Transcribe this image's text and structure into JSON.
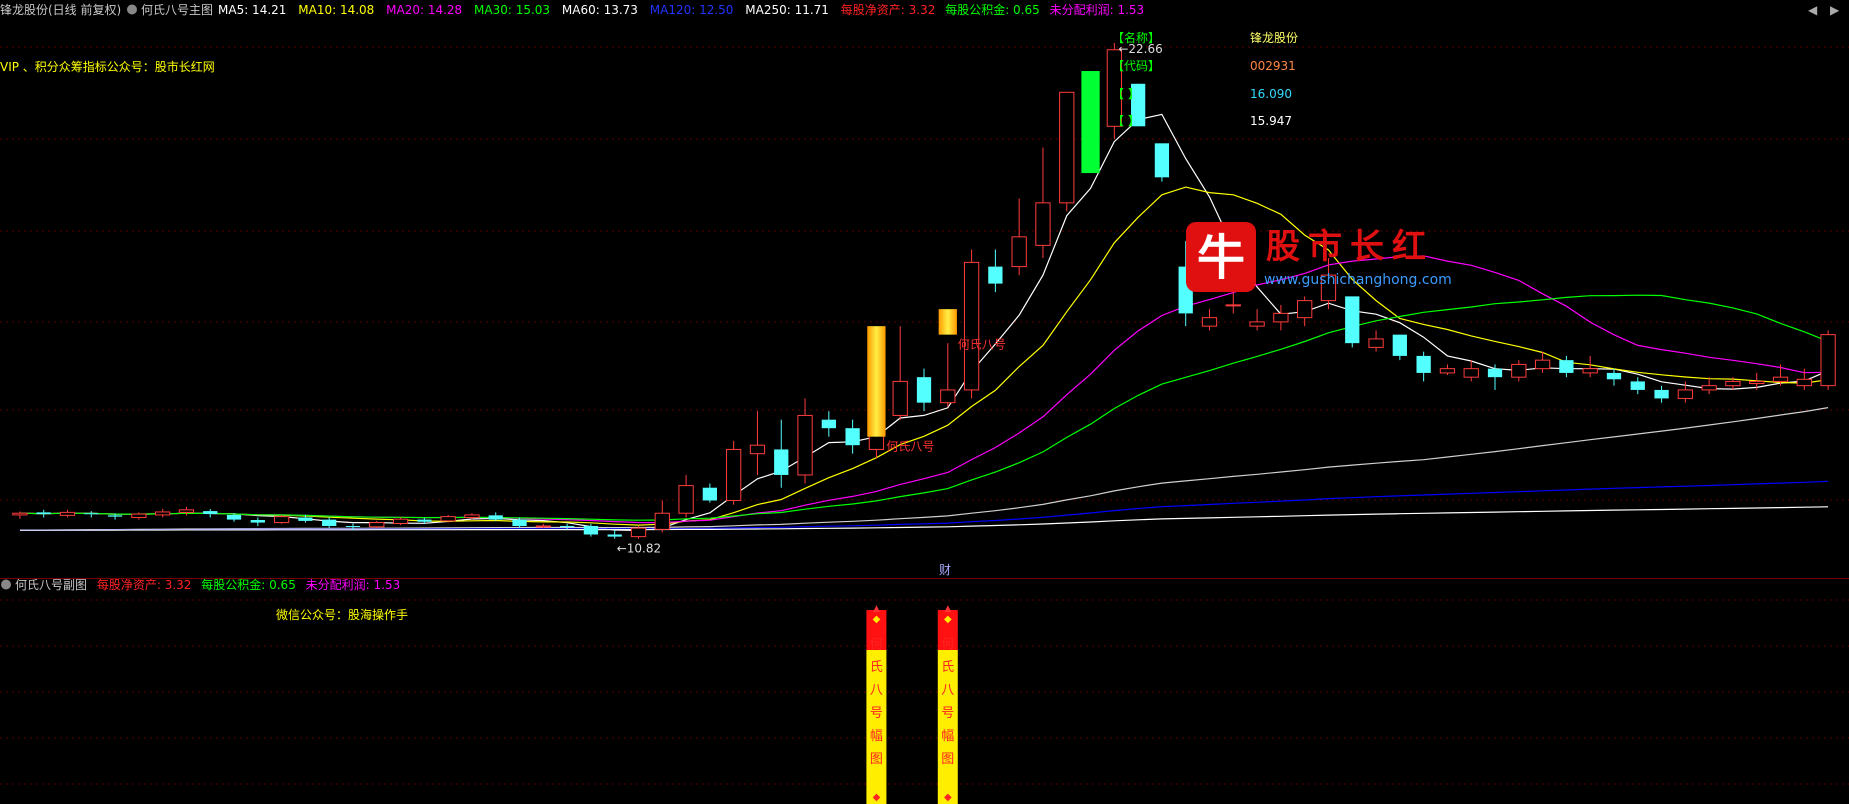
{
  "main_header": {
    "stock_title": "锋龙股份(日线 前复权)",
    "indicator_name": "何氏八号主图",
    "ma": [
      {
        "label": "MA5: 14.21",
        "color": "#ffffff"
      },
      {
        "label": "MA10: 14.08",
        "color": "#ffff00"
      },
      {
        "label": "MA20: 14.28",
        "color": "#ff00ff"
      },
      {
        "label": "MA30: 15.03",
        "color": "#00ff00"
      },
      {
        "label": "MA60: 13.73",
        "color": "#ffffff"
      },
      {
        "label": "MA120: 12.50",
        "color": "#0000ff"
      },
      {
        "label": "MA250: 11.71",
        "color": "#ffffff"
      }
    ],
    "fundamentals": [
      {
        "label": "每股净资产: 3.32",
        "color": "#ff2222"
      },
      {
        "label": "每股公积金: 0.65",
        "color": "#00ff00"
      },
      {
        "label": "未分配利润: 1.53",
        "color": "#ff00ff"
      }
    ]
  },
  "promo_top": "VIP 、积分众筹指标公众号：股市长红网",
  "info_panel": {
    "rows": [
      {
        "label": "【名称】",
        "value": "锋龙股份",
        "value_color": "#ffff66"
      },
      {
        "label": "【代码】",
        "value": "002931",
        "value_color": "#ff8844"
      },
      {
        "label": "【  】",
        "value": "16.090",
        "value_color": "#33ddff"
      },
      {
        "label": "【  】",
        "value": "15.947",
        "value_color": "#ffffff"
      }
    ]
  },
  "watermark": {
    "logo_char": "牛",
    "title": "股市长红",
    "url": "www.gushichanghong.com"
  },
  "signal_label": "何氏八号",
  "sub_header": {
    "indicator_name": "何氏八号副图",
    "fundamentals": [
      {
        "label": "每股净资产: 3.32",
        "color": "#ff2222"
      },
      {
        "label": "每股公积金: 0.65",
        "color": "#00ff00"
      },
      {
        "label": "未分配利润: 1.53",
        "color": "#ff00ff"
      }
    ]
  },
  "promo_sub": "微信公众号：股海操作手",
  "cai_marker": "财",
  "sub_signal_chars": [
    "何",
    "氏",
    "八",
    "号",
    "幅",
    "图"
  ],
  "chart_data": {
    "type": "candlestick",
    "ylim": [
      10.5,
      23.2
    ],
    "annotations": {
      "high": "22.66",
      "low": "10.82"
    },
    "candles": [
      [
        11.56,
        11.6,
        11.47,
        11.64
      ],
      [
        11.62,
        11.58,
        11.5,
        11.68
      ],
      [
        11.55,
        11.62,
        11.5,
        11.68
      ],
      [
        11.6,
        11.58,
        11.5,
        11.65
      ],
      [
        11.55,
        11.52,
        11.45,
        11.6
      ],
      [
        11.5,
        11.58,
        11.45,
        11.62
      ],
      [
        11.56,
        11.63,
        11.5,
        11.7
      ],
      [
        11.62,
        11.68,
        11.55,
        11.75
      ],
      [
        11.65,
        11.58,
        11.5,
        11.7
      ],
      [
        11.56,
        11.45,
        11.4,
        11.6
      ],
      [
        11.44,
        11.38,
        11.3,
        11.5
      ],
      [
        11.38,
        11.52,
        11.35,
        11.56
      ],
      [
        11.5,
        11.42,
        11.38,
        11.56
      ],
      [
        11.45,
        11.3,
        11.25,
        11.5
      ],
      [
        11.3,
        11.28,
        11.2,
        11.36
      ],
      [
        11.28,
        11.38,
        11.25,
        11.42
      ],
      [
        11.36,
        11.46,
        11.32,
        11.5
      ],
      [
        11.45,
        11.4,
        11.35,
        11.5
      ],
      [
        11.42,
        11.52,
        11.38,
        11.56
      ],
      [
        11.5,
        11.56,
        11.45,
        11.6
      ],
      [
        11.55,
        11.45,
        11.42,
        11.62
      ],
      [
        11.45,
        11.3,
        11.25,
        11.5
      ],
      [
        11.3,
        11.3,
        11.25,
        11.35
      ],
      [
        11.3,
        11.28,
        11.22,
        11.35
      ],
      [
        11.3,
        11.1,
        11.05,
        11.35
      ],
      [
        11.1,
        11.05,
        11.0,
        11.2
      ],
      [
        11.05,
        11.25,
        11.0,
        11.3
      ],
      [
        11.22,
        11.6,
        11.15,
        11.9
      ],
      [
        11.6,
        12.25,
        11.5,
        12.5
      ],
      [
        12.2,
        11.9,
        11.85,
        12.3
      ],
      [
        11.9,
        13.1,
        11.8,
        13.3
      ],
      [
        13.0,
        13.2,
        12.5,
        14.0
      ],
      [
        13.1,
        12.5,
        12.2,
        13.8
      ],
      [
        12.5,
        13.9,
        12.3,
        14.3
      ],
      [
        13.8,
        13.6,
        13.4,
        14.0
      ],
      [
        13.6,
        13.2,
        13.0,
        13.8
      ],
      [
        13.1,
        13.8,
        12.9,
        14.5
      ],
      [
        13.9,
        14.7,
        13.8,
        16.0
      ],
      [
        14.8,
        14.2,
        14.0,
        15.0
      ],
      [
        14.2,
        14.5,
        14.1,
        15.6
      ],
      [
        14.5,
        17.5,
        14.3,
        17.8
      ],
      [
        17.4,
        17.0,
        16.8,
        17.8
      ],
      [
        17.4,
        18.1,
        17.2,
        19.0
      ],
      [
        17.9,
        18.9,
        17.6,
        20.2
      ],
      [
        18.9,
        21.5,
        18.7,
        21.5
      ],
      [
        21.4,
        20.7,
        20.6,
        21.6
      ],
      [
        20.7,
        22.5,
        20.4,
        22.66
      ],
      [
        21.7,
        20.7,
        20.7,
        21.7
      ],
      [
        20.3,
        19.5,
        19.4,
        20.2
      ],
      [
        17.4,
        16.3,
        16.0,
        18.0
      ],
      [
        16.0,
        16.2,
        15.9,
        16.4
      ],
      [
        16.5,
        16.5,
        16.3,
        16.8
      ],
      [
        16.0,
        16.1,
        15.9,
        16.4
      ],
      [
        16.1,
        16.3,
        15.9,
        16.5
      ],
      [
        16.2,
        16.6,
        16.0,
        16.7
      ],
      [
        16.6,
        17.2,
        16.4,
        17.6
      ],
      [
        16.7,
        15.6,
        15.5,
        16.6
      ],
      [
        15.5,
        15.7,
        15.4,
        15.9
      ],
      [
        15.8,
        15.3,
        15.2,
        15.8
      ],
      [
        15.3,
        14.9,
        14.7,
        15.4
      ],
      [
        14.9,
        15.0,
        14.85,
        15.1
      ],
      [
        14.8,
        15.0,
        14.7,
        15.2
      ],
      [
        15.0,
        14.8,
        14.5,
        15.1
      ],
      [
        14.8,
        15.1,
        14.7,
        15.2
      ],
      [
        15.0,
        15.2,
        14.9,
        15.4
      ],
      [
        15.2,
        14.9,
        14.8,
        15.3
      ],
      [
        14.9,
        15.0,
        14.8,
        15.3
      ],
      [
        14.9,
        14.75,
        14.6,
        15.0
      ],
      [
        14.7,
        14.5,
        14.4,
        14.8
      ],
      [
        14.5,
        14.3,
        14.2,
        14.6
      ],
      [
        14.3,
        14.5,
        14.2,
        14.7
      ],
      [
        14.5,
        14.6,
        14.4,
        14.8
      ],
      [
        14.6,
        14.7,
        14.5,
        14.8
      ],
      [
        14.65,
        14.7,
        14.5,
        14.9
      ],
      [
        14.7,
        14.8,
        14.6,
        15.1
      ],
      [
        14.6,
        14.75,
        14.5,
        15.0
      ],
      [
        14.6,
        15.8,
        14.5,
        15.9
      ]
    ],
    "ma_lines": [
      {
        "name": "MA5",
        "color": "#ffffff"
      },
      {
        "name": "MA10",
        "color": "#ffff00"
      },
      {
        "name": "MA20",
        "color": "#ff00ff"
      },
      {
        "name": "MA30",
        "color": "#00ff00"
      },
      {
        "name": "MA60",
        "color": "#cfcfcf"
      },
      {
        "name": "MA120",
        "color": "#0000ff"
      },
      {
        "name": "MA250",
        "color": "#ffffff"
      }
    ],
    "highlight_bars": [
      {
        "index": 36,
        "open": 13.4,
        "close": 16.0,
        "style": "gold",
        "label": "何氏八号",
        "label_color": "#ff3333"
      },
      {
        "index": 39,
        "open": 15.8,
        "close": 16.4,
        "style": "gold",
        "label": "何氏八号",
        "label_color": "#ff3333"
      },
      {
        "index": 45,
        "open": 22.0,
        "close": 19.6,
        "style": "green"
      }
    ],
    "sub_signals": [
      {
        "index": 36
      },
      {
        "index": 39
      }
    ]
  }
}
